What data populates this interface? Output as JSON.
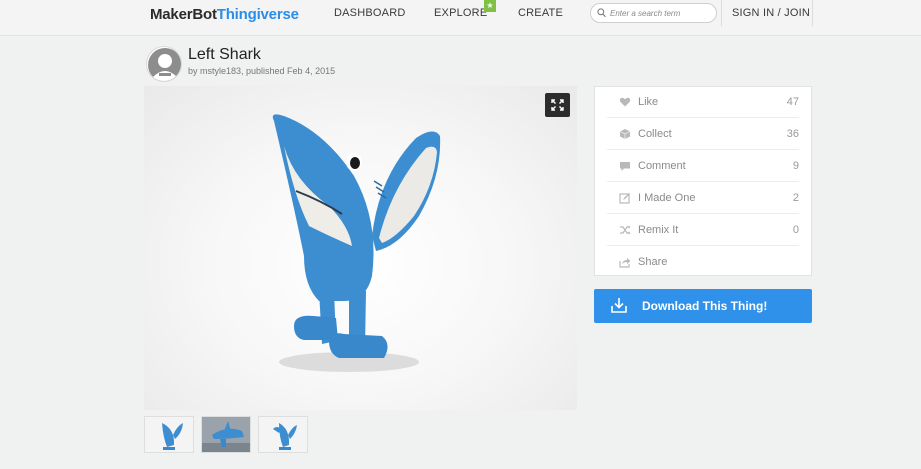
{
  "header": {
    "logo_maker": "MakerBot",
    "logo_thingiverse": "Thingiverse",
    "nav": [
      "DASHBOARD",
      "EXPLORE",
      "CREATE"
    ],
    "explore_badge": "★",
    "search_placeholder": "Enter a search term",
    "signin": "SIGN IN / JOIN"
  },
  "thing": {
    "title": "Left Shark",
    "byline": "by mstyle183, published Feb 4, 2015"
  },
  "actions": [
    {
      "label": "Like",
      "count": "47",
      "icon": "heart-icon"
    },
    {
      "label": "Collect",
      "count": "36",
      "icon": "collect-icon"
    },
    {
      "label": "Comment",
      "count": "9",
      "icon": "comment-icon"
    },
    {
      "label": "I Made One",
      "count": "2",
      "icon": "made-icon"
    },
    {
      "label": "Remix It",
      "count": "0",
      "icon": "remix-icon"
    },
    {
      "label": "Share",
      "count": "",
      "icon": "share-icon"
    }
  ],
  "download_label": "Download This Thing!",
  "colors": {
    "brand_blue": "#2f91ea",
    "badge_green": "#7fc142",
    "shark_blue": "#3d8ed0"
  }
}
